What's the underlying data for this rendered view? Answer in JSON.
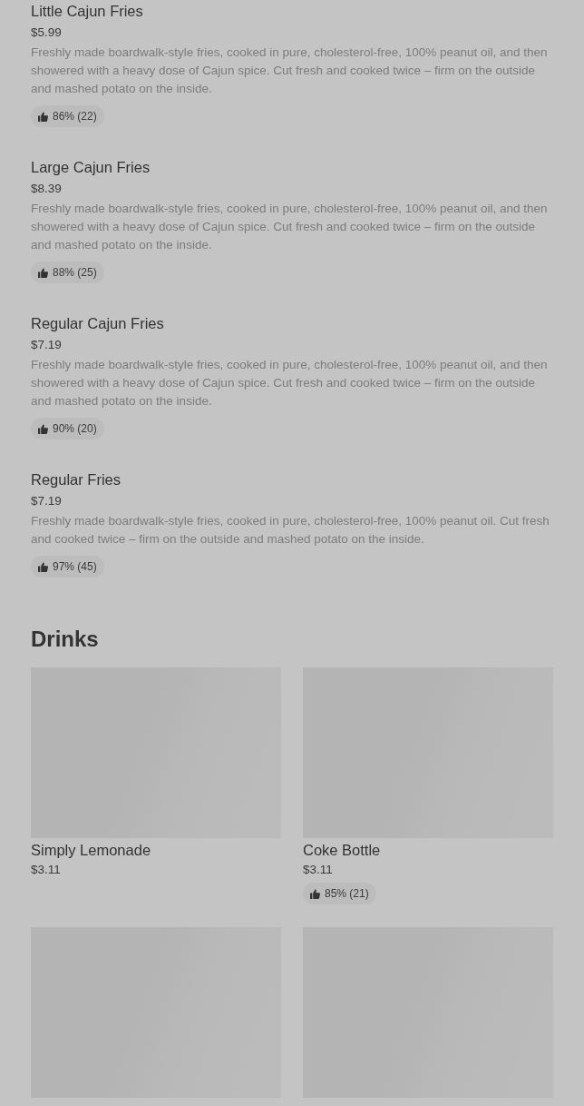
{
  "items": [
    {
      "name": "Little Cajun Fries",
      "price": "$5.99",
      "description": "Freshly made boardwalk-style fries, cooked in pure, cholesterol-free, 100% peanut oil, and then showered with a heavy dose of Cajun spice. Cut fresh and cooked twice – firm on the outside and mashed potato on the inside.",
      "rating": "86% (22)"
    },
    {
      "name": "Large Cajun Fries",
      "price": "$8.39",
      "description": "Freshly made boardwalk-style fries, cooked in pure, cholesterol-free, 100% peanut oil, and then showered with a heavy dose of Cajun spice. Cut fresh and cooked twice – firm on the outside and mashed potato on the inside.",
      "rating": "88% (25)"
    },
    {
      "name": "Regular Cajun Fries",
      "price": "$7.19",
      "description": "Freshly made boardwalk-style fries, cooked in pure, cholesterol-free, 100% peanut oil, and then showered with a heavy dose of Cajun spice. Cut fresh and cooked twice – firm on the outside and mashed potato on the inside.",
      "rating": "90% (20)"
    },
    {
      "name": "Regular Fries",
      "price": "$7.19",
      "description": "Freshly made boardwalk-style fries, cooked in pure, cholesterol-free, 100% peanut oil. Cut fresh and cooked twice – firm on the outside and mashed potato on the inside.",
      "rating": "97% (45)"
    }
  ],
  "drinks": {
    "title": "Drinks",
    "items": [
      {
        "image_loading": true,
        "name": "Simply Lemonade",
        "price": "$3.11"
      },
      {
        "image_loading": true,
        "name": "Coke Bottle",
        "price": "$3.11",
        "rating": "85% (21)"
      },
      {
        "image_loading": true
      },
      {
        "image_loading": true
      }
    ]
  }
}
